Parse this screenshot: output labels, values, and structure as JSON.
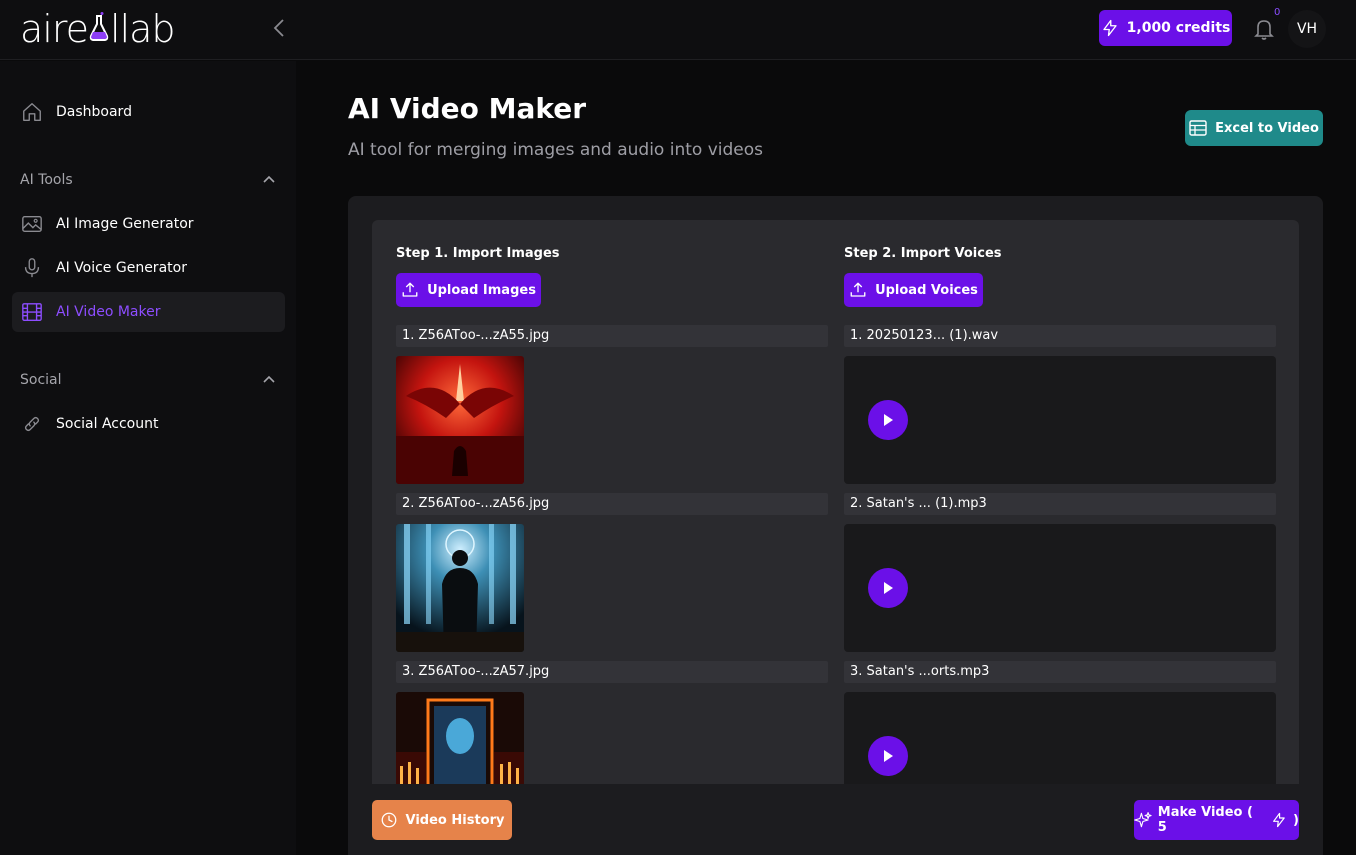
{
  "brand": {
    "logo_text_a": "aire",
    "logo_text_b": "llab"
  },
  "header": {
    "credits_label": "1,000 credits",
    "notification_count": "0",
    "avatar_initials": "VH"
  },
  "sidebar": {
    "dashboard": "Dashboard",
    "ai_tools_section": "AI Tools",
    "ai_tools_items": [
      "AI Image Generator",
      "AI Voice Generator",
      "AI Video Maker"
    ],
    "social_section": "Social",
    "social_items": [
      "Social Account"
    ]
  },
  "page": {
    "title": "AI Video Maker",
    "subtitle": "AI tool for merging images and audio into videos",
    "excel_button": "Excel to Video"
  },
  "steps": {
    "images_label": "Step 1. Import Images",
    "images_button": "Upload Images",
    "voices_label": "Step 2. Import Voices",
    "voices_button": "Upload Voices"
  },
  "images": [
    "1. Z56ATоо-...zA55.jpg",
    "2. Z56ATоо-...zA56.jpg",
    "3. Z56ATоо-...zA57.jpg"
  ],
  "voices": [
    "1. 20250123... (1).wav",
    "2. Satan's ... (1).mp3",
    "3. Satan's ...orts.mp3"
  ],
  "footer": {
    "history_button": "Video History",
    "make_button": "Make Video ( 5"
  },
  "colors": {
    "accent": "#6b10e8",
    "active_text": "#8d4dff",
    "teal": "#1f8a8a",
    "orange": "#e6834a"
  }
}
